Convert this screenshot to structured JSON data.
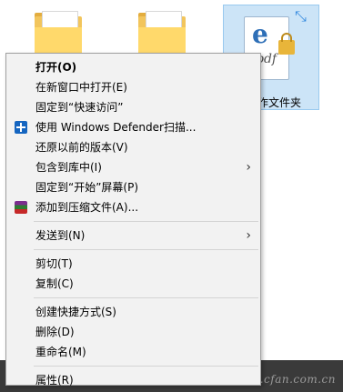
{
  "desktop": {
    "selected_item_label": "作文件夹",
    "watermark": "www.cfan.com.cn"
  },
  "menu": {
    "items": [
      {
        "label": "打开(O)"
      },
      {
        "label": "在新窗口中打开(E)"
      },
      {
        "label": "固定到“快速访问”"
      },
      {
        "label": "使用 Windows Defender扫描...",
        "icon": "windows-defender-icon"
      },
      {
        "label": "还原以前的版本(V)"
      },
      {
        "label": "包含到库中(I)",
        "submenu": true
      },
      {
        "label": "固定到“开始”屏幕(P)"
      },
      {
        "label": "添加到压缩文件(A)...",
        "icon": "winrar-icon"
      },
      {
        "label": "发送到(N)",
        "submenu": true
      },
      {
        "label": "剪切(T)"
      },
      {
        "label": "复制(C)"
      },
      {
        "label": "创建快捷方式(S)"
      },
      {
        "label": "删除(D)"
      },
      {
        "label": "重命名(M)"
      },
      {
        "label": "属性(R)"
      }
    ],
    "submenu_arrow": "›"
  }
}
